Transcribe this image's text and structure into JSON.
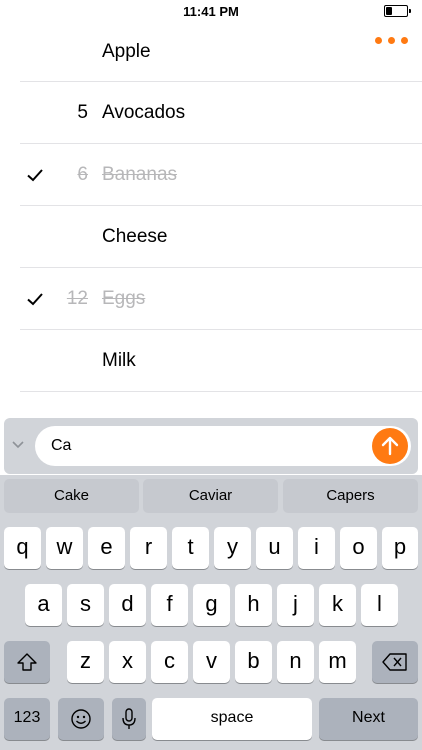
{
  "status": {
    "time": "11:41 PM",
    "battery_level": 0.3
  },
  "colors": {
    "accent": "#ff7a12",
    "done_text": "#b7b7b9",
    "keyboard_bg": "#d1d4d9"
  },
  "items": [
    {
      "qty": "",
      "name": "Apple",
      "done": false
    },
    {
      "qty": "5",
      "name": "Avocados",
      "done": false
    },
    {
      "qty": "6",
      "name": "Bananas",
      "done": true
    },
    {
      "qty": "",
      "name": "Cheese",
      "done": false
    },
    {
      "qty": "12",
      "name": "Eggs",
      "done": true
    },
    {
      "qty": "",
      "name": "Milk",
      "done": false
    }
  ],
  "input": {
    "value": "Ca"
  },
  "suggestions": [
    "Cake",
    "Caviar",
    "Capers"
  ],
  "keyboard": {
    "row1": [
      "q",
      "w",
      "e",
      "r",
      "t",
      "y",
      "u",
      "i",
      "o",
      "p"
    ],
    "row2": [
      "a",
      "s",
      "d",
      "f",
      "g",
      "h",
      "j",
      "k",
      "l"
    ],
    "row3": [
      "z",
      "x",
      "c",
      "v",
      "b",
      "n",
      "m"
    ],
    "numbers_label": "123",
    "space_label": "space",
    "return_label": "Next"
  }
}
